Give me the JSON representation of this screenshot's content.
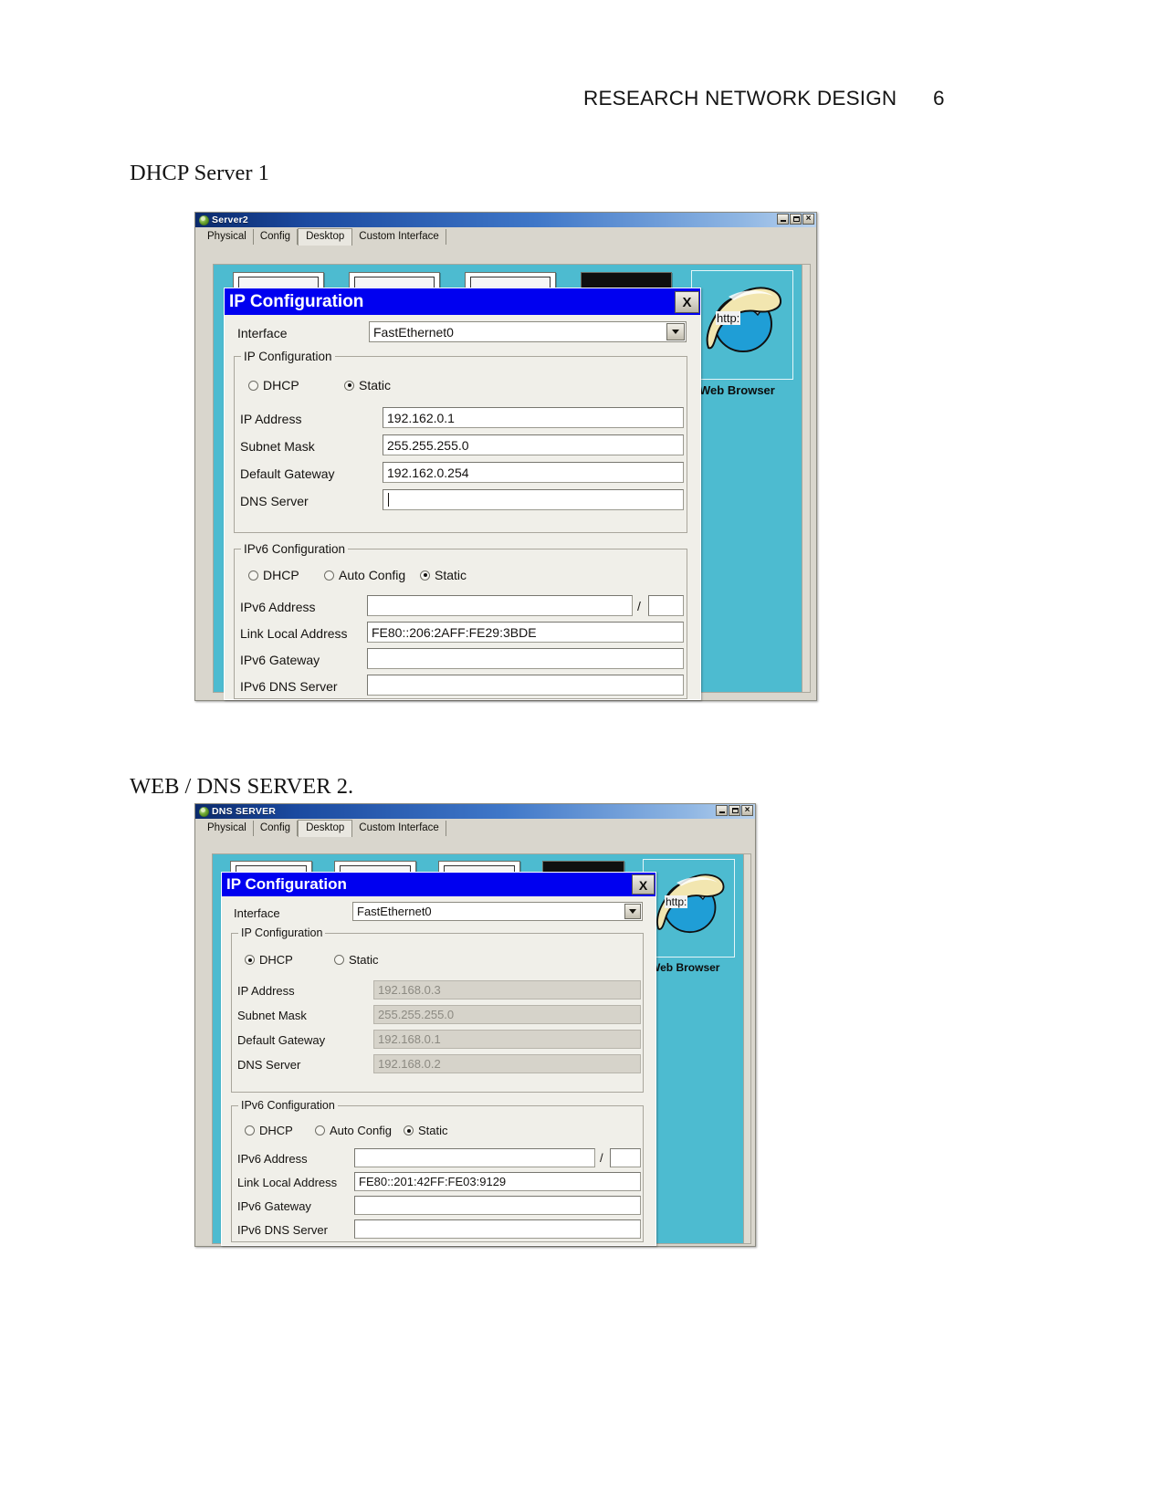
{
  "document": {
    "header_title": "RESEARCH NETWORK DESIGN",
    "page_number": "6",
    "heading_1": "DHCP Server 1",
    "heading_2": "WEB / DNS SERVER 2."
  },
  "window1": {
    "title": "Server2",
    "titlebar_icon": "packet-tracer-device-icon",
    "buttons": {
      "minimize": "_",
      "maximize": "□",
      "close": "x"
    },
    "tabs": [
      {
        "label": "Physical",
        "active": false
      },
      {
        "label": "Config",
        "active": false
      },
      {
        "label": "Desktop",
        "active": true
      },
      {
        "label": "Custom Interface",
        "active": false
      }
    ],
    "desktop": {
      "browser_label": "Web Browser",
      "browser_icon": "internet-explorer-icon",
      "browser_icon_text": "http:"
    },
    "dialog": {
      "title": "IP Configuration",
      "close_label": "X",
      "interface_label": "Interface",
      "interface_value": "FastEthernet0",
      "ipv4": {
        "group_title": "IP Configuration",
        "dhcp_label": "DHCP",
        "static_label": "Static",
        "selected": "Static",
        "fields": [
          {
            "label": "IP Address",
            "value": "192.162.0.1",
            "disabled": false
          },
          {
            "label": "Subnet Mask",
            "value": "255.255.255.0",
            "disabled": false
          },
          {
            "label": "Default Gateway",
            "value": "192.162.0.254",
            "disabled": false
          },
          {
            "label": "DNS Server",
            "value": "",
            "disabled": false
          }
        ]
      },
      "ipv6": {
        "group_title": "IPv6 Configuration",
        "dhcp_label": "DHCP",
        "auto_label": "Auto Config",
        "static_label": "Static",
        "selected": "Static",
        "prefix_separator": "/",
        "fields": [
          {
            "label": "IPv6 Address",
            "value": "",
            "disabled": false
          },
          {
            "label": "Link Local Address",
            "value": "FE80::206:2AFF:FE29:3BDE",
            "disabled": false
          },
          {
            "label": "IPv6 Gateway",
            "value": "",
            "disabled": false
          },
          {
            "label": "IPv6 DNS Server",
            "value": "",
            "disabled": false
          }
        ]
      }
    }
  },
  "window2": {
    "title": "DNS SERVER",
    "titlebar_icon": "packet-tracer-device-icon",
    "buttons": {
      "minimize": "_",
      "maximize": "□",
      "close": "x"
    },
    "tabs": [
      {
        "label": "Physical",
        "active": false
      },
      {
        "label": "Config",
        "active": false
      },
      {
        "label": "Desktop",
        "active": true
      },
      {
        "label": "Custom Interface",
        "active": false
      }
    ],
    "desktop": {
      "browser_label": "Web Browser",
      "browser_icon": "internet-explorer-icon",
      "browser_icon_text": "http:"
    },
    "dialog": {
      "title": "IP Configuration",
      "close_label": "X",
      "interface_label": "Interface",
      "interface_value": "FastEthernet0",
      "ipv4": {
        "group_title": "IP Configuration",
        "dhcp_label": "DHCP",
        "static_label": "Static",
        "selected": "DHCP",
        "fields": [
          {
            "label": "IP Address",
            "value": "192.168.0.3",
            "disabled": true
          },
          {
            "label": "Subnet Mask",
            "value": "255.255.255.0",
            "disabled": true
          },
          {
            "label": "Default Gateway",
            "value": "192.168.0.1",
            "disabled": true
          },
          {
            "label": "DNS Server",
            "value": "192.168.0.2",
            "disabled": true
          }
        ]
      },
      "ipv6": {
        "group_title": "IPv6 Configuration",
        "dhcp_label": "DHCP",
        "auto_label": "Auto Config",
        "static_label": "Static",
        "selected": "Static",
        "prefix_separator": "/",
        "fields": [
          {
            "label": "IPv6 Address",
            "value": "",
            "disabled": false
          },
          {
            "label": "Link Local Address",
            "value": "FE80::201:42FF:FE03:9129",
            "disabled": false
          },
          {
            "label": "IPv6 Gateway",
            "value": "",
            "disabled": false
          },
          {
            "label": "IPv6 DNS Server",
            "value": "",
            "disabled": false
          }
        ]
      }
    }
  }
}
